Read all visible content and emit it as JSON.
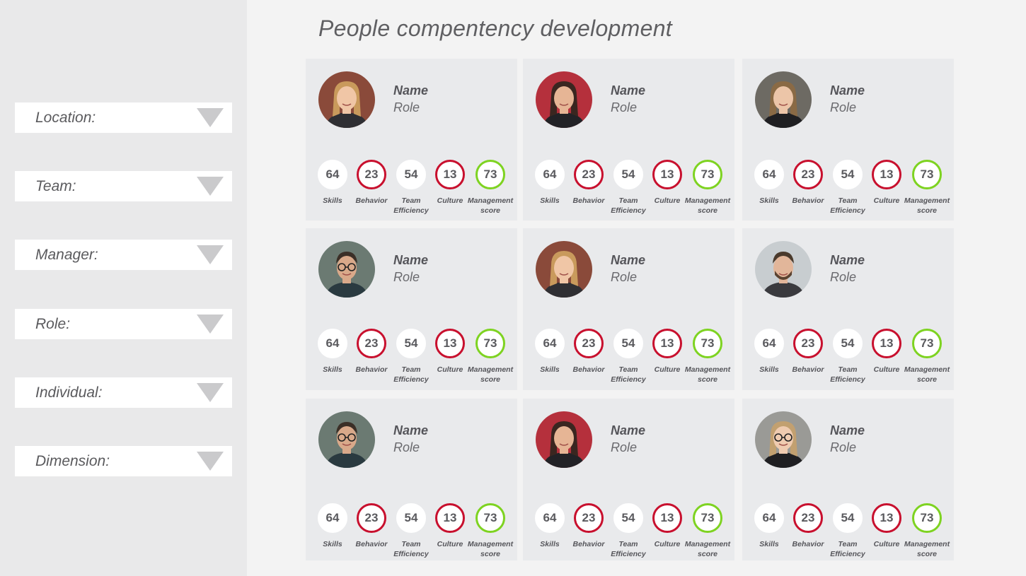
{
  "page": {
    "title": "People compentency development"
  },
  "filters": [
    {
      "label": "Location:",
      "icon": "triangle-down-icon"
    },
    {
      "label": "Team:",
      "icon": "triangle-down-icon"
    },
    {
      "label": "Manager:",
      "icon": "triangle-down-icon"
    },
    {
      "label": "Role:",
      "icon": "triangle-down-icon"
    },
    {
      "label": "Individual:",
      "icon": "triangle-down-icon"
    },
    {
      "label": "Dimension:",
      "icon": "triangle-down-icon"
    }
  ],
  "metric_labels": {
    "skills": "Skills",
    "behavior": "Behavior",
    "team_efficiency_1": "Team",
    "team_efficiency_2": "Efficiency",
    "culture": "Culture",
    "management_1": "Management",
    "management_2": "score"
  },
  "colors": {
    "low_score_ring": "#c8102e",
    "high_score_ring": "#7ed321",
    "card_bg": "#e9eaec",
    "sidebar_bg": "#e9e9ea"
  },
  "people": [
    {
      "name": "Name",
      "role": "Role",
      "avatar": "woman-blonde-photo",
      "skills": "64",
      "behavior": "23",
      "team_efficiency": "54",
      "culture": "13",
      "management": "73"
    },
    {
      "name": "Name",
      "role": "Role",
      "avatar": "woman-brunette-flag-photo",
      "skills": "64",
      "behavior": "23",
      "team_efficiency": "54",
      "culture": "13",
      "management": "73"
    },
    {
      "name": "Name",
      "role": "Role",
      "avatar": "woman-long-hair-photo",
      "skills": "64",
      "behavior": "23",
      "team_efficiency": "54",
      "culture": "13",
      "management": "73"
    },
    {
      "name": "Name",
      "role": "Role",
      "avatar": "man-glasses-photo",
      "skills": "64",
      "behavior": "23",
      "team_efficiency": "54",
      "culture": "13",
      "management": "73"
    },
    {
      "name": "Name",
      "role": "Role",
      "avatar": "woman-blonde-photo",
      "skills": "64",
      "behavior": "23",
      "team_efficiency": "54",
      "culture": "13",
      "management": "73"
    },
    {
      "name": "Name",
      "role": "Role",
      "avatar": "man-beard-photo",
      "skills": "64",
      "behavior": "23",
      "team_efficiency": "54",
      "culture": "13",
      "management": "73"
    },
    {
      "name": "Name",
      "role": "Role",
      "avatar": "man-glasses-photo",
      "skills": "64",
      "behavior": "23",
      "team_efficiency": "54",
      "culture": "13",
      "management": "73"
    },
    {
      "name": "Name",
      "role": "Role",
      "avatar": "woman-brunette-flag-photo",
      "skills": "64",
      "behavior": "23",
      "team_efficiency": "54",
      "culture": "13",
      "management": "73"
    },
    {
      "name": "Name",
      "role": "Role",
      "avatar": "woman-glasses-photo",
      "skills": "64",
      "behavior": "23",
      "team_efficiency": "54",
      "culture": "13",
      "management": "73"
    }
  ]
}
